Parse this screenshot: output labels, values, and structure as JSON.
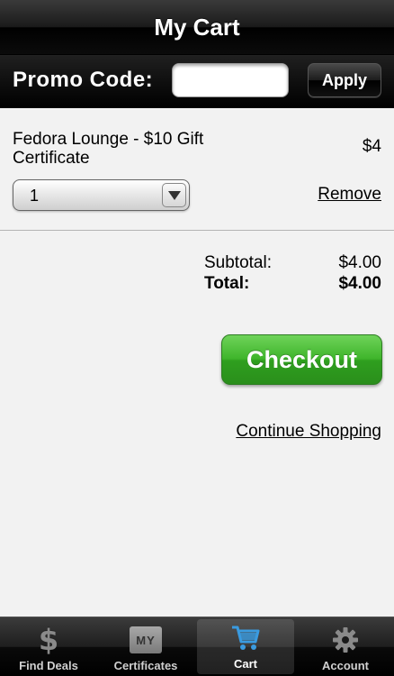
{
  "header": {
    "title": "My Cart"
  },
  "promo": {
    "label": "Promo Code:",
    "input_value": "",
    "apply_label": "Apply"
  },
  "cart": {
    "item": {
      "name": "Fedora Lounge - $10 Gift Certificate",
      "price": "$4",
      "quantity": "1",
      "remove_label": "Remove"
    }
  },
  "totals": {
    "subtotal_label": "Subtotal:",
    "subtotal_value": "$4.00",
    "total_label": "Total:",
    "total_value": "$4.00"
  },
  "actions": {
    "checkout_label": "Checkout",
    "continue_label": "Continue Shopping"
  },
  "tabs": [
    {
      "label": "Find Deals",
      "icon": "dollar-icon",
      "active": false
    },
    {
      "label": "Certificates",
      "icon": "my-certificates-icon",
      "badge": "MY",
      "active": false
    },
    {
      "label": "Cart",
      "icon": "cart-icon",
      "active": true
    },
    {
      "label": "Account",
      "icon": "gear-icon",
      "active": false
    }
  ],
  "colors": {
    "checkout_green": "#3fb52b",
    "cart_icon_blue": "#3a9be0",
    "background": "#f2f2f2"
  }
}
